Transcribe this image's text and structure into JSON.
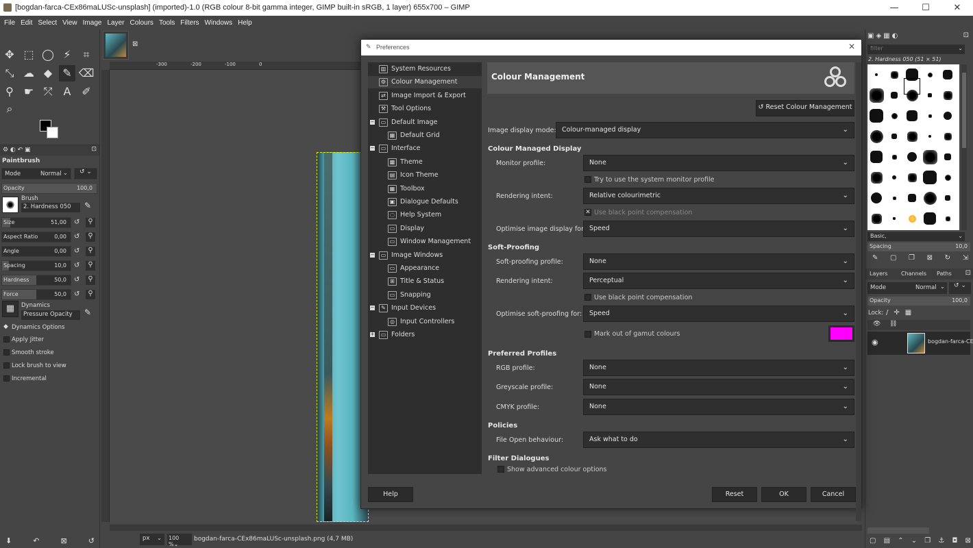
{
  "window": {
    "title": "[bogdan-farca-CEx86maLUSc-unsplash] (imported)-1.0 (RGB colour 8-bit gamma integer, GIMP built-in sRGB, 1 layer) 655x700 – GIMP"
  },
  "menu": [
    "File",
    "Edit",
    "Select",
    "View",
    "Image",
    "Layer",
    "Colours",
    "Tools",
    "Filters",
    "Windows",
    "Help"
  ],
  "tool_options": {
    "title": "Paintbrush",
    "mode_label": "Mode",
    "mode_value": "Normal",
    "opacity_label": "Opacity",
    "opacity_value": "100,0",
    "brush_label": "Brush",
    "brush_value": "2. Hardness 050",
    "sliders": [
      {
        "label": "Size",
        "value": "51,00"
      },
      {
        "label": "Aspect Ratio",
        "value": "0,00"
      },
      {
        "label": "Angle",
        "value": "0,00"
      },
      {
        "label": "Spacing",
        "value": "10,0"
      },
      {
        "label": "Hardness",
        "value": "50,0"
      },
      {
        "label": "Force",
        "value": "50,0"
      }
    ],
    "dynamics_label": "Dynamics",
    "dynamics_value": "Pressure Opacity",
    "options": [
      "Dynamics Options",
      "Apply Jitter",
      "Smooth stroke",
      "Lock brush to view",
      "Incremental"
    ]
  },
  "rulers": {
    "h_ticks": [
      "-300",
      "-200",
      "-100",
      "0"
    ]
  },
  "status": {
    "unit": "px",
    "zoom": "100 %",
    "file": "bogdan-farca-CEx86maLUSc-unsplash.png (4,7 MB)"
  },
  "brushes": {
    "filter_placeholder": "filter",
    "current": "2. Hardness 050 (51 × 51)",
    "tag": "Basic,",
    "spacing_label": "Spacing",
    "spacing_value": "10,0"
  },
  "layers": {
    "tabs": [
      "Layers",
      "Channels",
      "Paths"
    ],
    "mode_label": "Mode",
    "mode_value": "Normal",
    "opacity_label": "Opacity",
    "opacity_value": "100,0",
    "lock_label": "Lock:",
    "layer_name": "bogdan-farca-CE"
  },
  "prefs": {
    "title": "Preferences",
    "tree": [
      {
        "label": "System Resources",
        "level": 0,
        "exp": ""
      },
      {
        "label": "Colour Management",
        "level": 0,
        "exp": "",
        "sel": true
      },
      {
        "label": "Image Import & Export",
        "level": 0,
        "exp": ""
      },
      {
        "label": "Tool Options",
        "level": 0,
        "exp": ""
      },
      {
        "label": "Default Image",
        "level": 0,
        "exp": "−"
      },
      {
        "label": "Default Grid",
        "level": 1,
        "exp": ""
      },
      {
        "label": "Interface",
        "level": 0,
        "exp": "−"
      },
      {
        "label": "Theme",
        "level": 1,
        "exp": ""
      },
      {
        "label": "Icon Theme",
        "level": 1,
        "exp": ""
      },
      {
        "label": "Toolbox",
        "level": 1,
        "exp": ""
      },
      {
        "label": "Dialogue Defaults",
        "level": 1,
        "exp": ""
      },
      {
        "label": "Help System",
        "level": 1,
        "exp": ""
      },
      {
        "label": "Display",
        "level": 1,
        "exp": ""
      },
      {
        "label": "Window Management",
        "level": 1,
        "exp": ""
      },
      {
        "label": "Image Windows",
        "level": 0,
        "exp": "−"
      },
      {
        "label": "Appearance",
        "level": 1,
        "exp": ""
      },
      {
        "label": "Title & Status",
        "level": 1,
        "exp": ""
      },
      {
        "label": "Snapping",
        "level": 1,
        "exp": ""
      },
      {
        "label": "Input Devices",
        "level": 0,
        "exp": "−"
      },
      {
        "label": "Input Controllers",
        "level": 1,
        "exp": ""
      },
      {
        "label": "Folders",
        "level": 0,
        "exp": "+"
      }
    ],
    "page_title": "Colour Management",
    "reset_label": "Reset Colour Management",
    "display_mode_label": "Image display mode:",
    "display_mode_value": "Colour-managed display",
    "cmd_section": "Colour Managed Display",
    "monitor_label": "Monitor profile:",
    "monitor_value": "None",
    "sys_monitor": "Try to use the system monitor profile",
    "render_label": "Rendering intent:",
    "render_value": "Relative colourimetric",
    "bpc1": "Use black point compensation",
    "opt_display_label": "Optimise image display for:",
    "opt_display_value": "Speed",
    "soft_section": "Soft-Proofing",
    "soft_profile_label": "Soft-proofing profile:",
    "soft_profile_value": "None",
    "soft_render_label": "Rendering intent:",
    "soft_render_value": "Perceptual",
    "bpc2": "Use black point compensation",
    "opt_soft_label": "Optimise soft-proofing for:",
    "opt_soft_value": "Speed",
    "gamut": "Mark out of gamut colours",
    "gamut_color": "#ff00ff",
    "pref_section": "Preferred Profiles",
    "rgb_label": "RGB profile:",
    "rgb_value": "None",
    "grey_label": "Greyscale profile:",
    "grey_value": "None",
    "cmyk_label": "CMYK profile:",
    "cmyk_value": "None",
    "policies_section": "Policies",
    "fileopen_label": "File Open behaviour:",
    "fileopen_value": "Ask what to do",
    "filter_section": "Filter Dialogues",
    "adv_colour": "Show advanced colour options",
    "help": "Help",
    "reset": "Reset",
    "ok": "OK",
    "cancel": "Cancel"
  }
}
